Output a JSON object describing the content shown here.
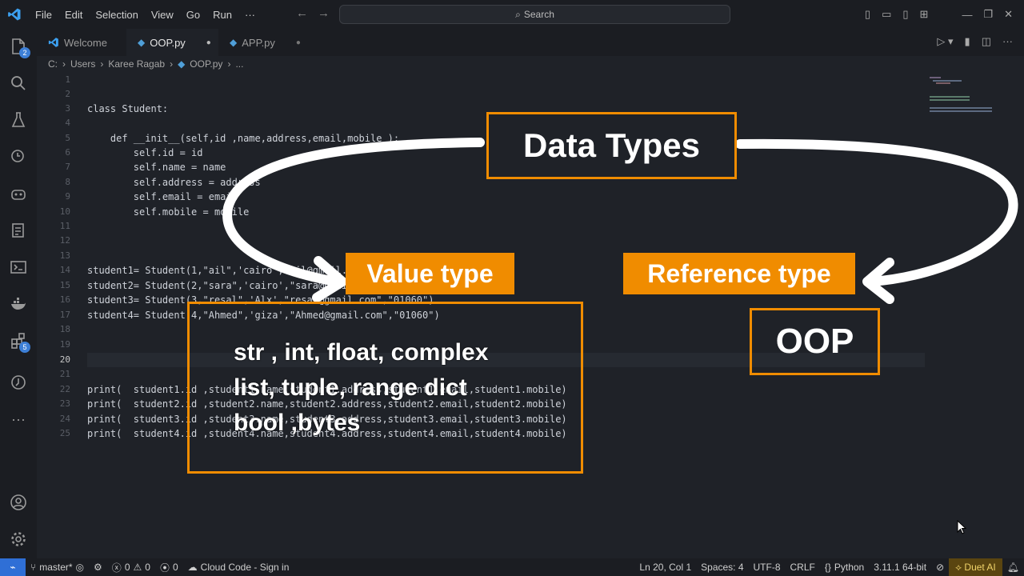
{
  "titlebar": {
    "menu": [
      "File",
      "Edit",
      "Selection",
      "View",
      "Go",
      "Run",
      "···"
    ],
    "search_placeholder": "Search"
  },
  "activity_badges": {
    "explorer": "2",
    "extensions": "5"
  },
  "tabs": [
    {
      "label": "Welcome",
      "icon": "vscode-logo-icon",
      "active": false
    },
    {
      "label": "OOP.py",
      "icon": "python-file-icon",
      "active": true,
      "modified": true
    },
    {
      "label": "APP.py",
      "icon": "python-file-icon",
      "active": false,
      "modified": true
    }
  ],
  "breadcrumb": [
    "C:",
    "Users",
    "Karee Ragab",
    "OOP.py",
    "..."
  ],
  "editor": {
    "line_numbers": [
      "1",
      "2",
      "3",
      "4",
      "5",
      "6",
      "7",
      "8",
      "9",
      "10",
      "11",
      "12",
      "13",
      "14",
      "15",
      "16",
      "17",
      "18",
      "19",
      "20",
      "21",
      "22",
      "23",
      "24",
      "25"
    ],
    "lines": {
      "l3": "class Student:",
      "l5": "    def __init__(self,id ,name,address,email,mobile ):",
      "l6": "        self.id = id",
      "l7": "        self.name = name",
      "l8": "        self.address = address",
      "l9": "        self.email = email",
      "l10": "        self.mobile = mobile",
      "l14": "student1= Student(1,\"ail\",'cairo','ail@gmail.com','01060')",
      "l15": "student2= Student(2,\"sara\",'cairo',\"sara@gmail.com\",\"01060\")",
      "l16": "student3= Student(3,\"resal\",'Alx',\"resal@gmail.com\",\"01060\")",
      "l17": "student4= Student(4,\"Ahmed\",'giza',\"Ahmed@gmail.com\",\"01060\")",
      "l22": "print(  student1.id ,student1.name,student1.address,student1.email,student1.mobile)",
      "l23": "print(  student2.id ,student2.name,student2.address,student2.email,student2.mobile)",
      "l24": "print(  student3.id ,student3.name,student3.address,student3.email,student3.mobile)",
      "l25": "print(  student4.id ,student4.name,student4.address,student4.email,student4.mobile)"
    }
  },
  "overlay": {
    "title": "Data Types",
    "value_type": "Value type",
    "reference_type": "Reference type",
    "value_list": [
      "str , int, float, complex",
      "list, tuple, range dict",
      "bool ,bytes"
    ],
    "oop": "OOP",
    "accent": "#f08c00"
  },
  "statusbar": {
    "branch": "master*",
    "errors": "0",
    "warnings": "0",
    "ports": "0",
    "cloud": "Cloud Code - Sign in",
    "position": "Ln 20, Col 1",
    "spaces": "Spaces: 4",
    "encoding": "UTF-8",
    "eol": "CRLF",
    "language": "Python",
    "interpreter": "3.11.1 64-bit",
    "duet": "Duet AI"
  }
}
